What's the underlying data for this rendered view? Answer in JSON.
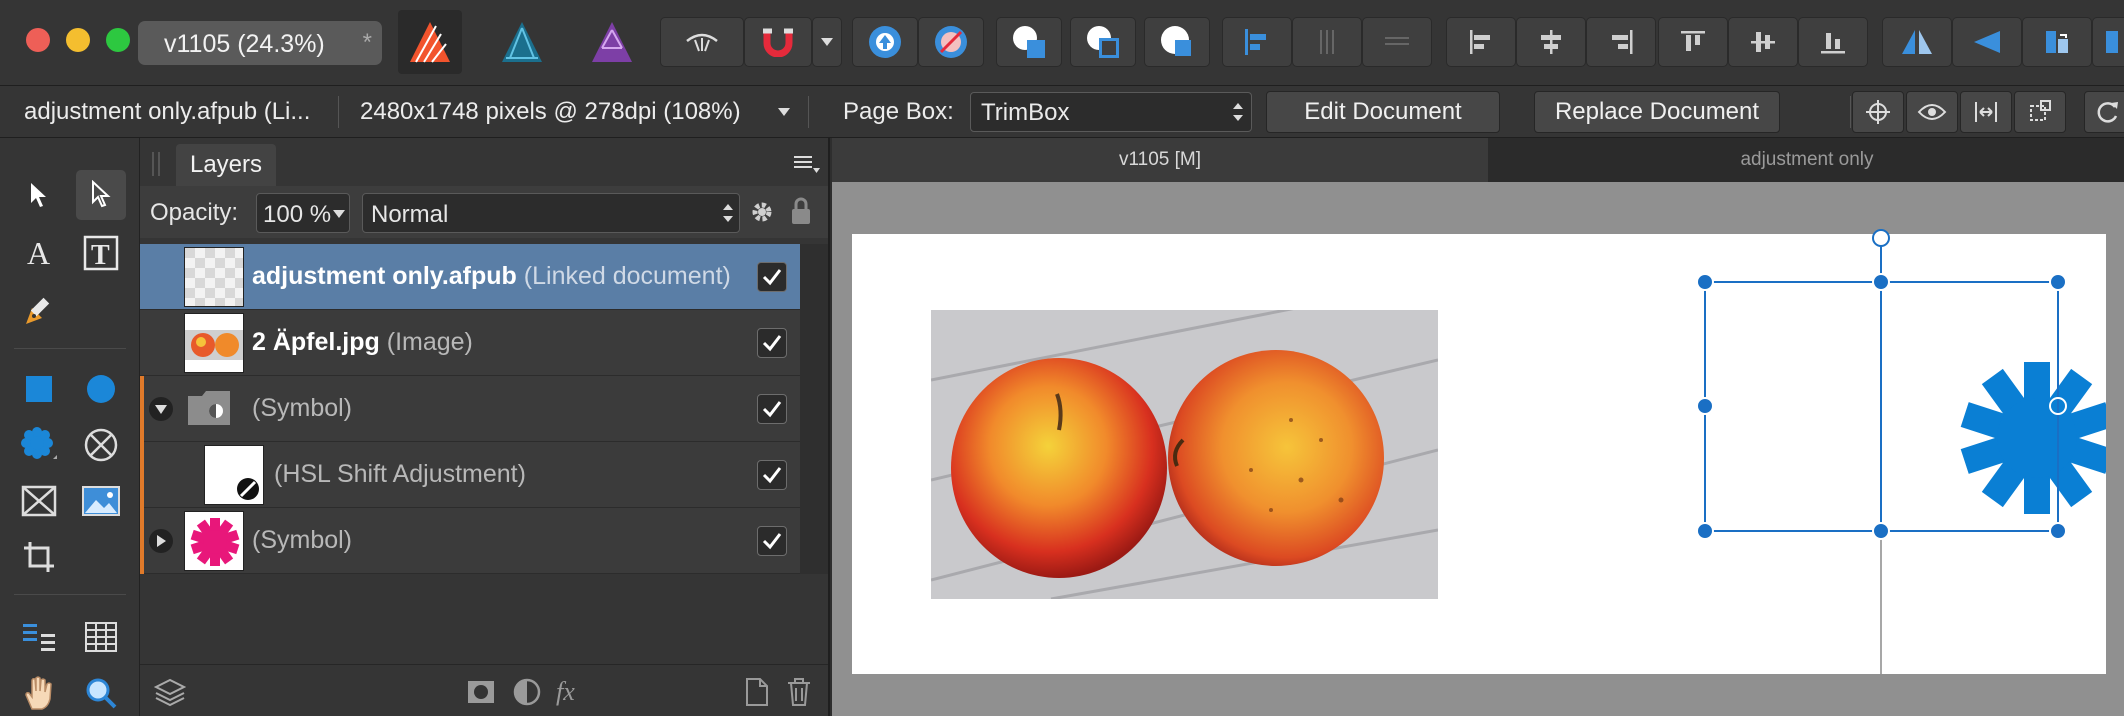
{
  "window": {
    "doc_tab_title": "v1105  (24.3%)",
    "doc_tab_close": "*"
  },
  "context_bar": {
    "document_name": "adjustment only.afpub (Li...",
    "dimensions": "2480x1748 pixels @ 278dpi (108%)",
    "page_box_label": "Page Box:",
    "page_box_value": "TrimBox",
    "edit_document": "Edit Document",
    "replace_document": "Replace Document"
  },
  "layers_panel": {
    "tab_label": "Layers",
    "opacity_label": "Opacity:",
    "opacity_value": "100 %",
    "blend_mode": "Normal",
    "rows": [
      {
        "name": "adjustment only.afpub",
        "type": "(Linked document)",
        "checked": true,
        "selected": true
      },
      {
        "name": "2 Äpfel.jpg",
        "type": "(Image)",
        "checked": true
      },
      {
        "name": "",
        "type": "(Symbol)",
        "checked": true,
        "expanded": true
      },
      {
        "name": "",
        "type": "(HSL Shift Adjustment)",
        "checked": true
      },
      {
        "name": "",
        "type": "(Symbol)",
        "checked": true,
        "expanded": false
      }
    ]
  },
  "document_tabs": [
    {
      "label": "v1105  [M]",
      "active": true
    },
    {
      "label": "adjustment only",
      "active": false
    }
  ],
  "colors": {
    "selection_blue": "#1a6fc4",
    "star_blue": "#0a7fd4",
    "symbol_pink": "#e8177a",
    "layer_selected": "#5a7ea6",
    "accent_orange": "#e07a2a"
  }
}
